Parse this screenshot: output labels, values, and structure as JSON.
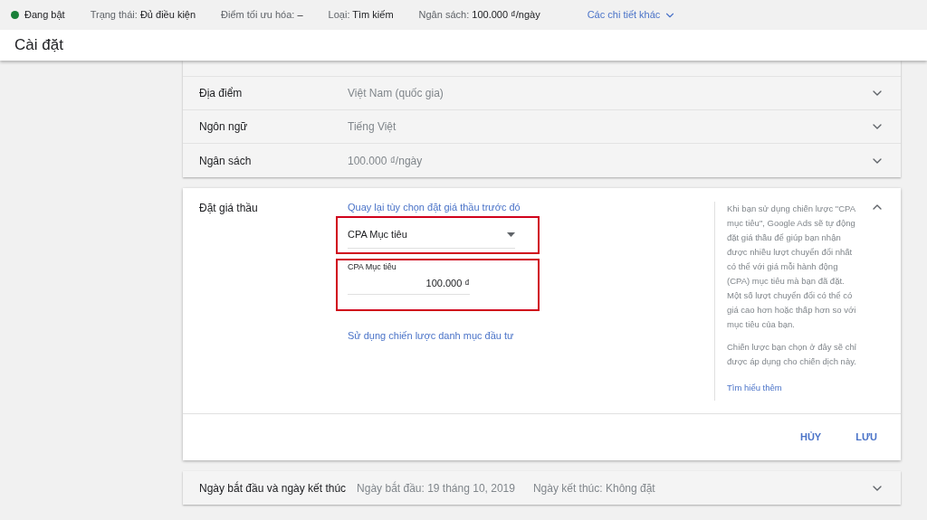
{
  "status_bar": {
    "state": {
      "label": "Đang bật",
      "color": "#188038"
    },
    "items": [
      {
        "label": "Trạng thái:",
        "value": "Đủ điều kiện"
      },
      {
        "label": "Điểm tối ưu hóa:",
        "value": "–"
      },
      {
        "label": "Loại:",
        "value": "Tìm kiếm"
      },
      {
        "label": "Ngân sách:",
        "value": "100.000 ₫/ngày"
      }
    ],
    "more_link": "Các chi tiết khác"
  },
  "page_title": "Cài đặt",
  "settings_rows": [
    {
      "label": "Địa điểm",
      "value": "Việt Nam (quốc gia)"
    },
    {
      "label": "Ngôn ngữ",
      "value": "Tiếng Việt"
    },
    {
      "label": "Ngân sách",
      "value": "100.000 ₫/ngày"
    }
  ],
  "bidding": {
    "label": "Đặt giá thầu",
    "expanded": true,
    "back_link": "Quay lại tùy chọn đặt giá thầu trước đó",
    "strategy_select": {
      "value": "CPA Mục tiêu",
      "highlighted": true
    },
    "target_field": {
      "label": "CPA Mục tiêu",
      "value": "100.000 ₫",
      "highlighted": true
    },
    "portfolio_link": "Sử dụng chiến lược danh mục đầu tư",
    "help_paragraphs": [
      "Khi bạn sử dụng chiến lược \"CPA mục tiêu\", Google Ads sẽ tự động đặt giá thầu để giúp bạn nhận được nhiều lượt chuyển đổi nhất có thể với giá mỗi hành động (CPA) mục tiêu mà bạn đã đặt. Một số lượt chuyển đổi có thể có giá cao hơn hoặc thấp hơn so với mục tiêu của bạn.",
      "Chiến lược bạn chọn ở đây sẽ chỉ được áp dụng cho chiến dịch này."
    ],
    "learn_more": "Tìm hiểu thêm",
    "buttons": [
      "HỦY",
      "LƯU"
    ]
  },
  "dates_row": {
    "label": "Ngày bắt đầu và ngày kết thúc",
    "start": "Ngày bắt đầu: 19 tháng 10, 2019",
    "end": "Ngày kết thúc: Không đặt"
  }
}
